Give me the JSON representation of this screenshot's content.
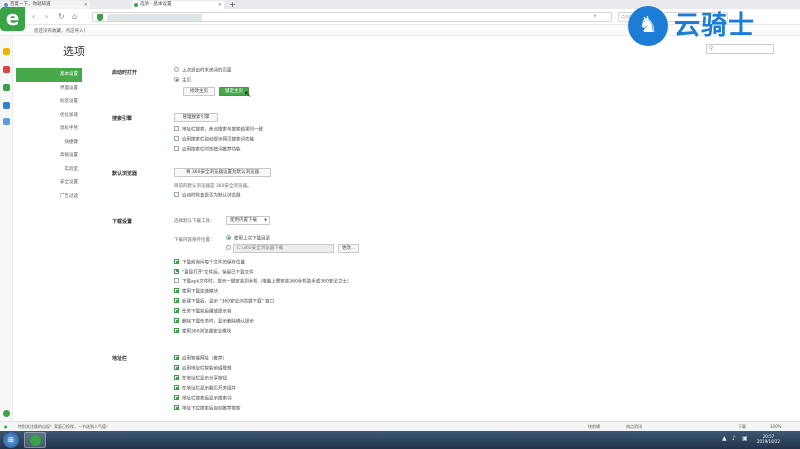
{
  "browser": {
    "tabs": [
      {
        "label": "百度一下，你就知道"
      },
      {
        "label": "选项 - 基本设置"
      }
    ],
    "new_tab": "+",
    "nav": {
      "back": "‹",
      "forward": "›",
      "reload": "↻",
      "home": "⌂"
    },
    "address_bolt": "⚡",
    "search_placeholder": "点击搜索",
    "favorites_hint": "您还没有收藏，点这导入！",
    "logo_letter": "e"
  },
  "brand": {
    "name": "云骑士",
    "horse": "♞"
  },
  "page": {
    "title": "选项",
    "search_icon": "⚲"
  },
  "nav": {
    "items": [
      {
        "label": "基本设置",
        "active": true
      },
      {
        "label": "界面设置",
        "active": false
      },
      {
        "label": "标签设置",
        "active": false
      },
      {
        "label": "优化加速",
        "active": false
      },
      {
        "label": "鼠标手势",
        "active": false
      },
      {
        "label": "快捷键",
        "active": false
      },
      {
        "label": "高级设置",
        "active": false
      },
      {
        "label": "实验室",
        "active": false
      },
      {
        "label": "安全设置",
        "active": false
      },
      {
        "label": "广告过滤",
        "active": false
      }
    ]
  },
  "startup": {
    "title": "启动时打开",
    "opt_last": "上次退出时未关闭的页面",
    "opt_home": "主页",
    "btn_change_home": "修改主页",
    "btn_lock_home": "锁定主页"
  },
  "search_engine": {
    "title": "搜索引擎",
    "btn_manage": "管理搜索引擎",
    "opt1": "地址栏搜索，焦点搜索与搜索结果同一致",
    "opt2": "启用搜索栏自动提示网页搜索词功能",
    "opt3": "启用搜索栏时热搜词推荐功能"
  },
  "default_browser": {
    "title": "默认浏览器",
    "btn_set": "将 360安全浏览器设置为默认浏览器",
    "hint": "目前的默认浏览器是 360安全浏览器。",
    "opt_check": "启动时检查是否为默认浏览器"
  },
  "download": {
    "title": "下载设置",
    "tool_label": "选择默认下载工具：",
    "tool_value": "使用内置下载",
    "save_label": "下载内容保存位置：",
    "opt_last_dir": "使用上次下载目录",
    "path_value": "C:\\360安全浏览器下载",
    "btn_change": "更改...",
    "options": [
      {
        "label": "下载前询问每个文件的保存位置",
        "checked": true
      },
      {
        "label": "\"直接打开\"文件后，保留已下载文件",
        "checked": true
      },
      {
        "label": "下载apk文件时，提示一键安装到手机（电脑上需安装360手机助手或360安全卫士）",
        "checked": false
      },
      {
        "label": "使用下载加速模块",
        "checked": true
      },
      {
        "label": "新建下载后，显示 \"360安全浏览器下载\" 窗口",
        "checked": true
      },
      {
        "label": "任务下载完后播放提示音",
        "checked": true
      },
      {
        "label": "删除下载任务时，显示删除确认提示",
        "checked": true
      },
      {
        "label": "使用360浏览器安全模块",
        "checked": true
      }
    ]
  },
  "address_bar": {
    "title": "地址栏",
    "options": [
      {
        "label": "启用智能网址（推荐）",
        "checked": true
      },
      {
        "label": "启用地址栏智能前缀联想",
        "checked": true
      },
      {
        "label": "在地址栏显示分享按钮",
        "checked": true
      },
      {
        "label": "在地址栏显示翻页开关插件",
        "checked": true
      },
      {
        "label": "地址栏搜索后显示搜索词",
        "checked": true
      },
      {
        "label": "地址下拉搜索后自动推荐搜索",
        "checked": true
      }
    ]
  },
  "status": {
    "message": "特别关注版的出现！家庭已投保，一节选到人气值！",
    "items": [
      "快剪辑",
      "热点资讯",
      "下载",
      "100%"
    ]
  },
  "taskbar": {
    "start": "⊞",
    "time": "20:57",
    "date": "2019/10/22",
    "tray": [
      "▲",
      "♪",
      "▣"
    ]
  }
}
